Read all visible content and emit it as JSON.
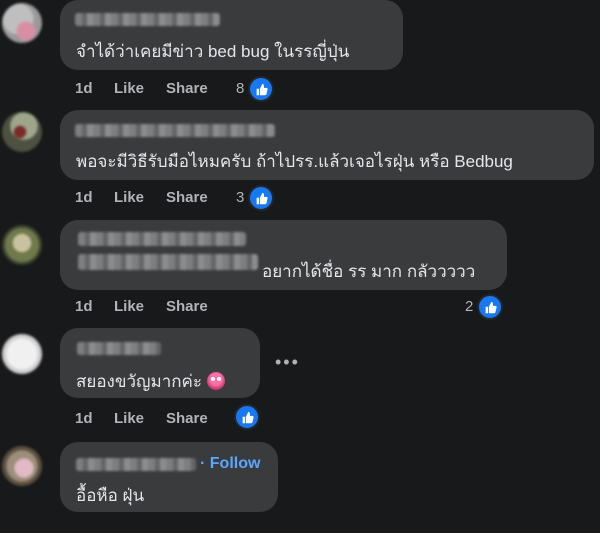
{
  "comments": [
    {
      "text": "จำได้ว่าเคยมีข่าว bed bug ในรรญี่ปุ่น",
      "time": "1d",
      "like_label": "Like",
      "share_label": "Share",
      "reactions": "8",
      "reaction_icon": "thumbs-up-icon"
    },
    {
      "text": "พอจะมีวิธีรับมือไหมครับ ถ้าไปรร.แล้วเจอไรฝุ่น หรือ Bedbug",
      "time": "1d",
      "like_label": "Like",
      "share_label": "Share",
      "reactions": "3",
      "reaction_icon": "thumbs-up-icon"
    },
    {
      "text": "อยากได้ชื่อ รร มาก กลัววววว",
      "time": "1d",
      "like_label": "Like",
      "share_label": "Share",
      "reactions": "2",
      "reaction_icon": "thumbs-up-icon"
    },
    {
      "text": "สยองขวัญมากค่ะ",
      "emoji": "face-with-spiral-eyes",
      "time": "1d",
      "like_label": "Like",
      "share_label": "Share",
      "reactions": "",
      "reaction_icon": "thumbs-up-icon",
      "more_icon": "more-options-icon"
    },
    {
      "text": "อื้อหือ ฝุ่น",
      "follow_label": "Follow",
      "follow_separator": "·"
    }
  ],
  "colors": {
    "background": "#18191a",
    "bubble": "#3a3b3c",
    "text": "#e4e6eb",
    "meta": "#b0b3b8",
    "accent": "#1877f2",
    "follow": "#5aa7ff"
  }
}
